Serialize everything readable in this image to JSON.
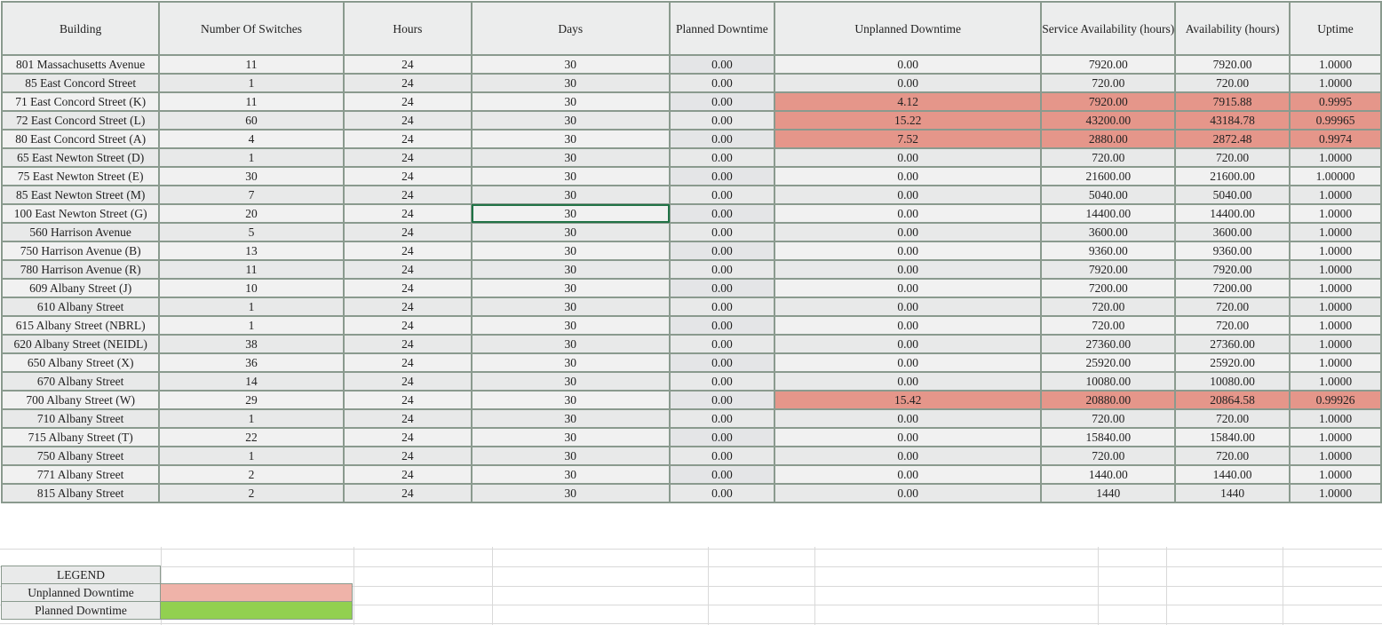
{
  "headers": [
    "Building",
    "Number Of Switches",
    "Hours",
    "Days",
    "Planned Downtime",
    "Unplanned Downtime",
    "Service Availability (hours)",
    "Availability (hours)",
    "Uptime"
  ],
  "rows": [
    [
      "801 Massachusetts Avenue",
      "11",
      "24",
      "30",
      "0.00",
      "0.00",
      "7920.00",
      "7920.00",
      "1.0000"
    ],
    [
      "85 East Concord Street",
      "1",
      "24",
      "30",
      "0.00",
      "0.00",
      "720.00",
      "720.00",
      "1.0000"
    ],
    [
      "71 East Concord Street (K)",
      "11",
      "24",
      "30",
      "0.00",
      "4.12",
      "7920.00",
      "7915.88",
      "0.9995"
    ],
    [
      "72 East Concord Street (L)",
      "60",
      "24",
      "30",
      "0.00",
      "15.22",
      "43200.00",
      "43184.78",
      "0.99965"
    ],
    [
      "80 East Concord Street (A)",
      "4",
      "24",
      "30",
      "0.00",
      "7.52",
      "2880.00",
      "2872.48",
      "0.9974"
    ],
    [
      "65 East Newton Street (D)",
      "1",
      "24",
      "30",
      "0.00",
      "0.00",
      "720.00",
      "720.00",
      "1.0000"
    ],
    [
      "75 East Newton Street (E)",
      "30",
      "24",
      "30",
      "0.00",
      "0.00",
      "21600.00",
      "21600.00",
      "1.00000"
    ],
    [
      "85 East Newton Street (M)",
      "7",
      "24",
      "30",
      "0.00",
      "0.00",
      "5040.00",
      "5040.00",
      "1.0000"
    ],
    [
      "100 East Newton Street (G)",
      "20",
      "24",
      "30",
      "0.00",
      "0.00",
      "14400.00",
      "14400.00",
      "1.0000"
    ],
    [
      "560 Harrison Avenue",
      "5",
      "24",
      "30",
      "0.00",
      "0.00",
      "3600.00",
      "3600.00",
      "1.0000"
    ],
    [
      "750 Harrison Avenue (B)",
      "13",
      "24",
      "30",
      "0.00",
      "0.00",
      "9360.00",
      "9360.00",
      "1.0000"
    ],
    [
      "780 Harrison Avenue (R)",
      "11",
      "24",
      "30",
      "0.00",
      "0.00",
      "7920.00",
      "7920.00",
      "1.0000"
    ],
    [
      "609 Albany Street (J)",
      "10",
      "24",
      "30",
      "0.00",
      "0.00",
      "7200.00",
      "7200.00",
      "1.0000"
    ],
    [
      "610 Albany Street",
      "1",
      "24",
      "30",
      "0.00",
      "0.00",
      "720.00",
      "720.00",
      "1.0000"
    ],
    [
      "615 Albany Street (NBRL)",
      "1",
      "24",
      "30",
      "0.00",
      "0.00",
      "720.00",
      "720.00",
      "1.0000"
    ],
    [
      "620 Albany Street (NEIDL)",
      "38",
      "24",
      "30",
      "0.00",
      "0.00",
      "27360.00",
      "27360.00",
      "1.0000"
    ],
    [
      "650 Albany Street (X)",
      "36",
      "24",
      "30",
      "0.00",
      "0.00",
      "25920.00",
      "25920.00",
      "1.0000"
    ],
    [
      "670 Albany Street",
      "14",
      "24",
      "30",
      "0.00",
      "0.00",
      "10080.00",
      "10080.00",
      "1.0000"
    ],
    [
      "700 Albany Street (W)",
      "29",
      "24",
      "30",
      "0.00",
      "15.42",
      "20880.00",
      "20864.58",
      "0.99926"
    ],
    [
      "710 Albany Street",
      "1",
      "24",
      "30",
      "0.00",
      "0.00",
      "720.00",
      "720.00",
      "1.0000"
    ],
    [
      "715 Albany Street (T)",
      "22",
      "24",
      "30",
      "0.00",
      "0.00",
      "15840.00",
      "15840.00",
      "1.0000"
    ],
    [
      "750 Albany Street",
      "1",
      "24",
      "30",
      "0.00",
      "0.00",
      "720.00",
      "720.00",
      "1.0000"
    ],
    [
      "771 Albany Street",
      "2",
      "24",
      "30",
      "0.00",
      "0.00",
      "1440.00",
      "1440.00",
      "1.0000"
    ],
    [
      "815 Albany Street",
      "2",
      "24",
      "30",
      "0.00",
      "0.00",
      "1440",
      "1440",
      "1.0000"
    ]
  ],
  "highlighted_rows": [
    2,
    3,
    4,
    18
  ],
  "selected_cell": {
    "row": 8,
    "col": 3
  },
  "legend": {
    "title": "LEGEND",
    "items": [
      {
        "label": "Unplanned Downtime",
        "color": "#efb3a9"
      },
      {
        "label": "Planned Downtime",
        "color": "#92d050"
      }
    ]
  },
  "colors": {
    "highlight": "#e5968a",
    "border": "#8a9a8e",
    "selection": "#217346"
  }
}
